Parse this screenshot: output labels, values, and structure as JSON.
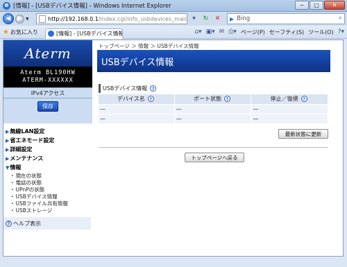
{
  "window": {
    "title": "[情報] - [USBデバイス情報] - Windows Internet Explorer",
    "min_label": "−",
    "max_label": "□",
    "close_label": "✕"
  },
  "addressbar": {
    "url_host": "http://192.168.0.1",
    "url_path": "/index.cgi/info_usbdevices_main",
    "search_engine": "Bing",
    "search_placeholder": ""
  },
  "favorites": {
    "label": "お気に入り",
    "tab_title": "[情報] - [USBデバイス情報]",
    "menu_page": "ページ(P)",
    "menu_safety": "セーフティ(S)",
    "menu_tools": "ツール(O)"
  },
  "sidebar": {
    "logo": "Aterm",
    "model_line1": "Aterm BL190HW",
    "model_line2": "ATERM-XXXXXX",
    "mode": "IPv4アクセス",
    "save_label": "保存",
    "menu": [
      {
        "label": "無線LAN設定"
      },
      {
        "label": "省エネモード設定"
      },
      {
        "label": "詳細設定"
      },
      {
        "label": "メンテナンス"
      },
      {
        "label": "情報"
      }
    ],
    "submenu": [
      {
        "label": "現在の状態"
      },
      {
        "label": "電話の状態"
      },
      {
        "label": "UPnPの状態"
      },
      {
        "label": "USBデバイス情報"
      },
      {
        "label": "USBファイル共有情報"
      },
      {
        "label": "USBストレージ"
      }
    ],
    "help_label": "ヘルプ表示"
  },
  "main": {
    "breadcrumb": "トップページ ＞ 情報 ＞ USBデバイス情報",
    "page_title": "USBデバイス情報",
    "section_title": "USBデバイス情報",
    "columns": [
      "デバイス名",
      "ポート状態",
      "停止／復帰"
    ],
    "rows": [
      [
        "—",
        "—",
        "—"
      ],
      [
        "—",
        "—",
        "—"
      ]
    ],
    "refresh_button": "最新状態に更新",
    "top_button": "トップページへ戻る"
  },
  "colors": {
    "header_blue": "#1b52bd",
    "sidebar_bg": "#ccdcf2",
    "table_header": "#dbe4f3"
  }
}
